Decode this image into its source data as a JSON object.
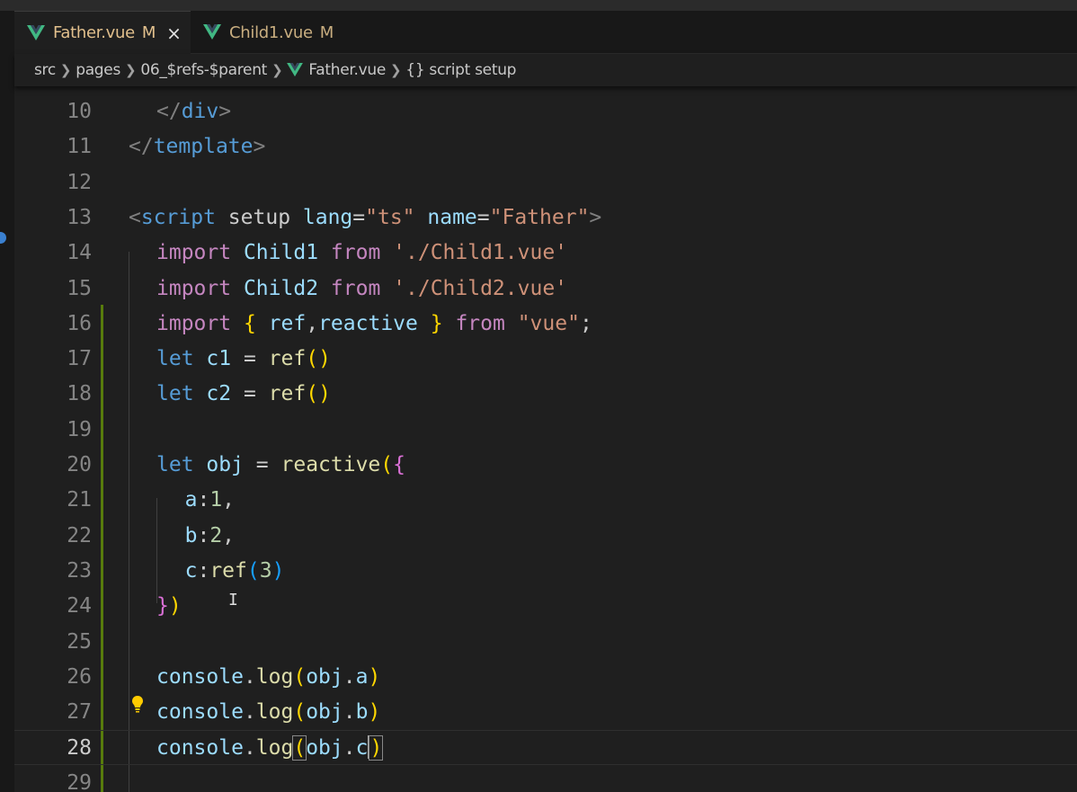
{
  "tabs": [
    {
      "label": "Father.vue",
      "status": "M",
      "active": true,
      "close": "×"
    },
    {
      "label": "Child1.vue",
      "status": "M",
      "active": false
    }
  ],
  "breadcrumb": {
    "items": [
      "src",
      "pages",
      "06_$refs-$parent",
      "Father.vue",
      "{} script setup"
    ]
  },
  "editor": {
    "current_line": 28,
    "lines": [
      {
        "n": "10",
        "text": "  </div>"
      },
      {
        "n": "11",
        "text": "</template>"
      },
      {
        "n": "12",
        "text": ""
      },
      {
        "n": "13",
        "text": "<script setup lang=\"ts\" name=\"Father\">"
      },
      {
        "n": "14",
        "text": "  import Child1 from './Child1.vue'"
      },
      {
        "n": "15",
        "text": "  import Child2 from './Child2.vue'"
      },
      {
        "n": "16",
        "text": "  import { ref,reactive } from \"vue\";"
      },
      {
        "n": "17",
        "text": "  let c1 = ref()"
      },
      {
        "n": "18",
        "text": "  let c2 = ref()"
      },
      {
        "n": "19",
        "text": ""
      },
      {
        "n": "20",
        "text": "  let obj = reactive({"
      },
      {
        "n": "21",
        "text": "    a:1,"
      },
      {
        "n": "22",
        "text": "    b:2,"
      },
      {
        "n": "23",
        "text": "    c:ref(3)"
      },
      {
        "n": "24",
        "text": "  })"
      },
      {
        "n": "25",
        "text": ""
      },
      {
        "n": "26",
        "text": "  console.log(obj.a)"
      },
      {
        "n": "27",
        "text": "  console.log(obj.b)"
      },
      {
        "n": "28",
        "text": "  console.log(obj.c)"
      },
      {
        "n": "29",
        "text": ""
      }
    ]
  },
  "colors": {
    "keyword": "#569cd6",
    "control": "#c586c0",
    "string": "#ce9178",
    "variable": "#9cdcfe",
    "function": "#dcdcaa",
    "number": "#b5cea8",
    "git_modified": "#587c0c",
    "vue_green": "#41b883",
    "tab_modified": "#e2c08d"
  },
  "icons": [
    "vue-file-icon",
    "close-icon",
    "chevron-right-icon",
    "lightbulb-icon",
    "text-cursor-icon"
  ]
}
